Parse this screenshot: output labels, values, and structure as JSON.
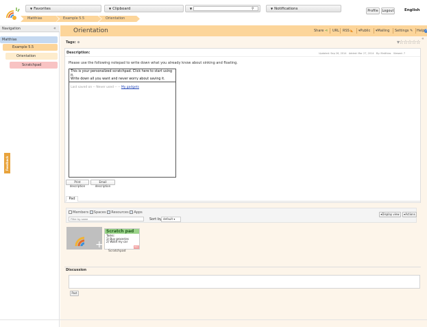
{
  "header": {
    "menus": {
      "favorites": "Favorites",
      "clipboard": "Clipboard",
      "search_menu": "",
      "notifications": "Notifications"
    },
    "search_placeholder": "",
    "profile": "Profile",
    "logout": "Logout",
    "language": "English"
  },
  "breadcrumb": [
    "Matthias",
    "Example 5.5",
    "Orientation"
  ],
  "nav": {
    "title": "Navigation",
    "collapse": "«",
    "items": [
      "Matthias",
      "Example 5.5",
      "Orientation",
      "Scratchpad"
    ],
    "feedback": "Feedback"
  },
  "page": {
    "title": "Orientation",
    "toolbar": {
      "share": "Share",
      "url": "URL",
      "rss": "RSS",
      "public": "Public",
      "mailing": "Mailing",
      "settings": "Settings",
      "help": "Help"
    },
    "tags_label": "Tags:",
    "description_label": "Description:",
    "meta": {
      "updated": "Updated: Sep 26, 2014",
      "added": "Added: Mar 27, 2014",
      "by": "By: Matthias",
      "viewed": "Viewed: 7"
    },
    "description_text": "Please use the following notepad to write down what you already know about sinking and floating.",
    "scratchpad": {
      "line1": "This is your personalized scratchpad. Click here to start using it.",
      "line2": "Write down all you want and never worry about saving it.",
      "last_saved": "Last saved on -- Never used --",
      "gadgets_link": "My gadgets"
    },
    "print_description": "Print description",
    "email_description": "Email description",
    "pad_tab": "Pad",
    "filters": {
      "members": "Members",
      "spaces": "Spaces",
      "resources": "Resources",
      "apps": "Apps",
      "filter_placeholder": "Filter by name",
      "sort_by": "Sort by",
      "sort_value": "default",
      "display_view": "Display view",
      "actions": "Actions"
    },
    "item": {
      "app_title": "Scratch pad",
      "app_lines": [
        "Tasks:",
        "1) Buy groceries",
        "2) Wash my car"
      ],
      "badge": "Mini",
      "caption": "Scratchpad"
    },
    "discussion_label": "Discussion",
    "post": "Post"
  },
  "colors": {
    "accent_orange": "#fcd59a",
    "nav_blue": "#c5d9f1",
    "scratch_green": "#9bd48a"
  }
}
